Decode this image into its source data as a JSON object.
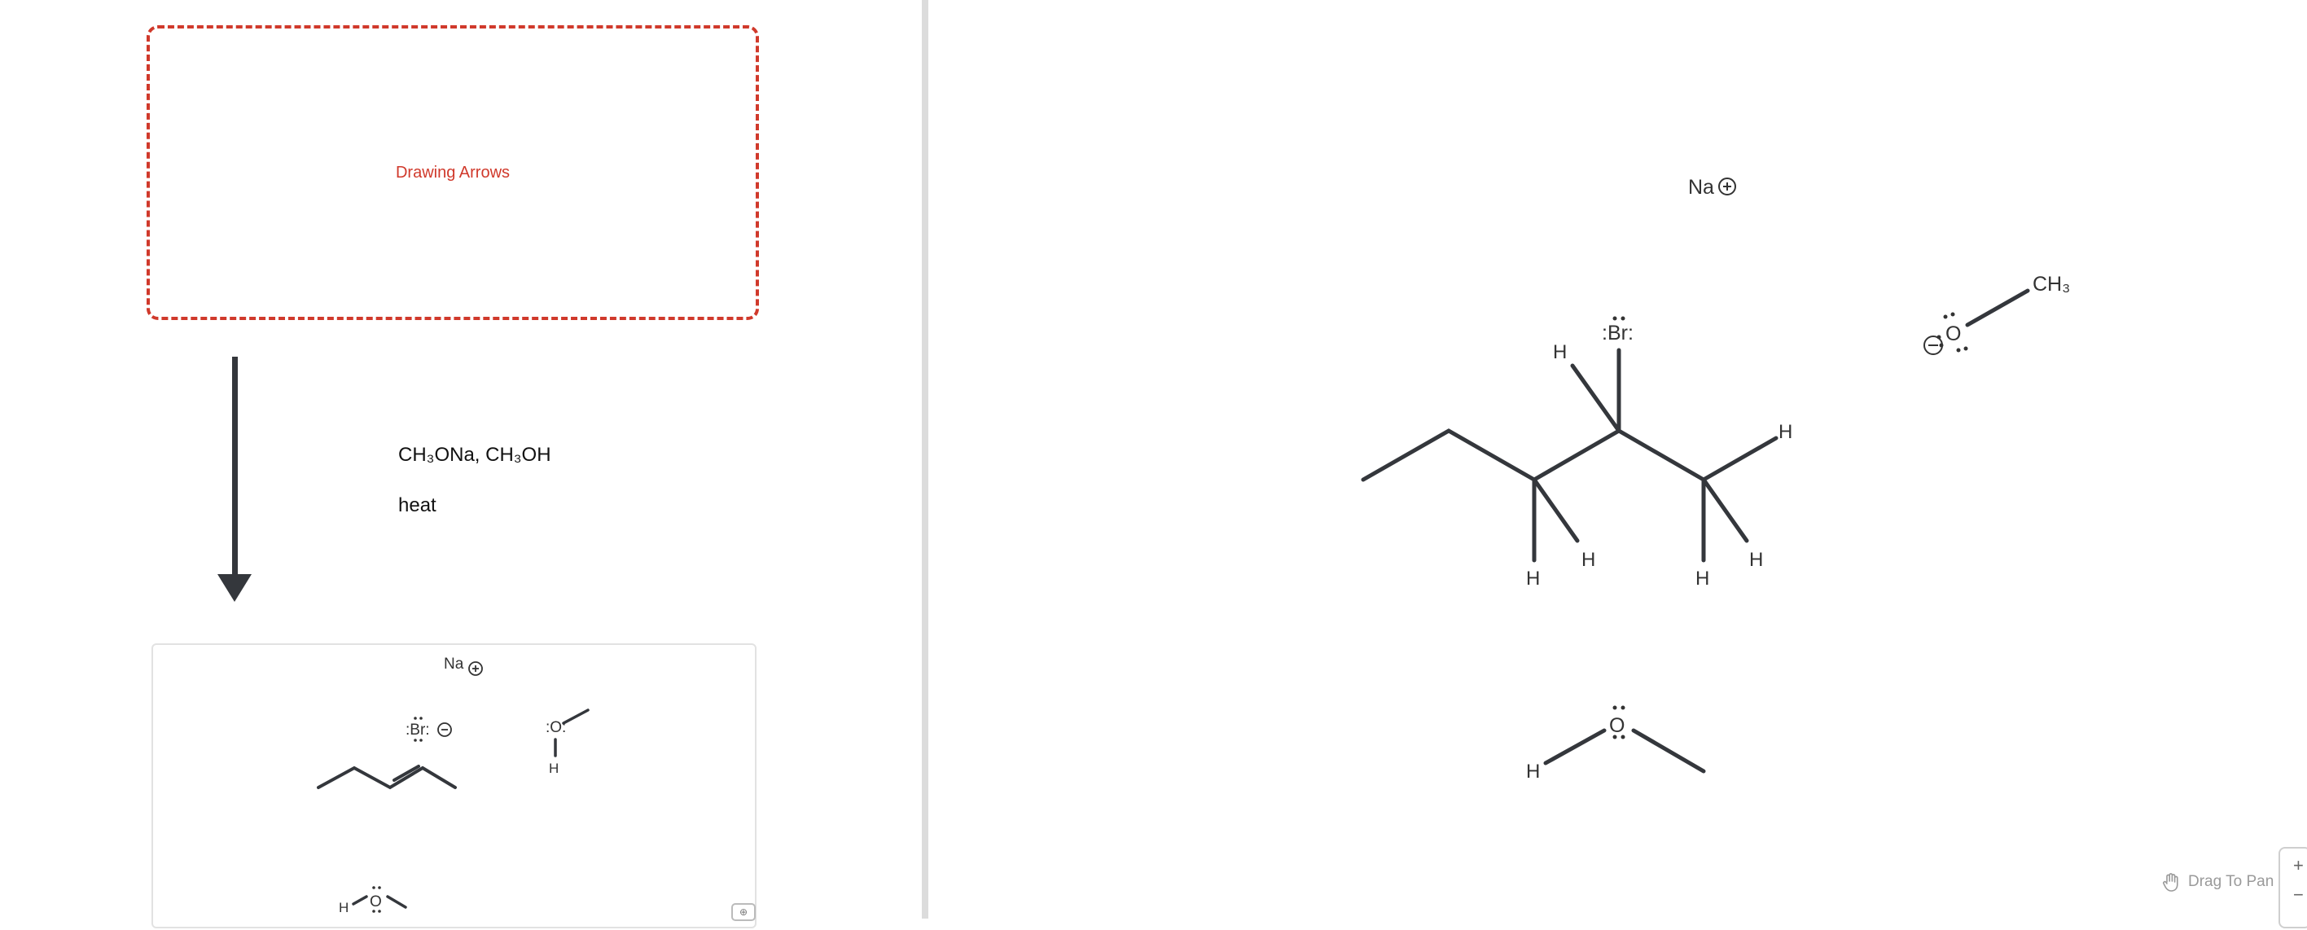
{
  "left_panel": {
    "drop_zone_label": "Drawing Arrows",
    "conditions": [
      "CH₃ONa, CH₃OH",
      "heat"
    ],
    "product_box": {
      "na_label": "Na",
      "methanol_h": "H",
      "product_br": ":Br:",
      "byproduct_h": "H",
      "byproduct_o": ":O:",
      "expand_icon": "expand-icon"
    }
  },
  "canvas": {
    "na_label": "Na",
    "br_label": ":Br:",
    "h_labels": [
      "H",
      "H",
      "H",
      "H",
      "H",
      "H"
    ],
    "methoxide_o": "O",
    "methoxide_ch3": "CH₃",
    "methanol_o": "O",
    "methanol_h": "H",
    "drag_hint": "Drag To Pan",
    "zoom_in": "+",
    "zoom_out": "−"
  },
  "colors": {
    "accent": "#d0392b",
    "ink": "#34373c"
  }
}
